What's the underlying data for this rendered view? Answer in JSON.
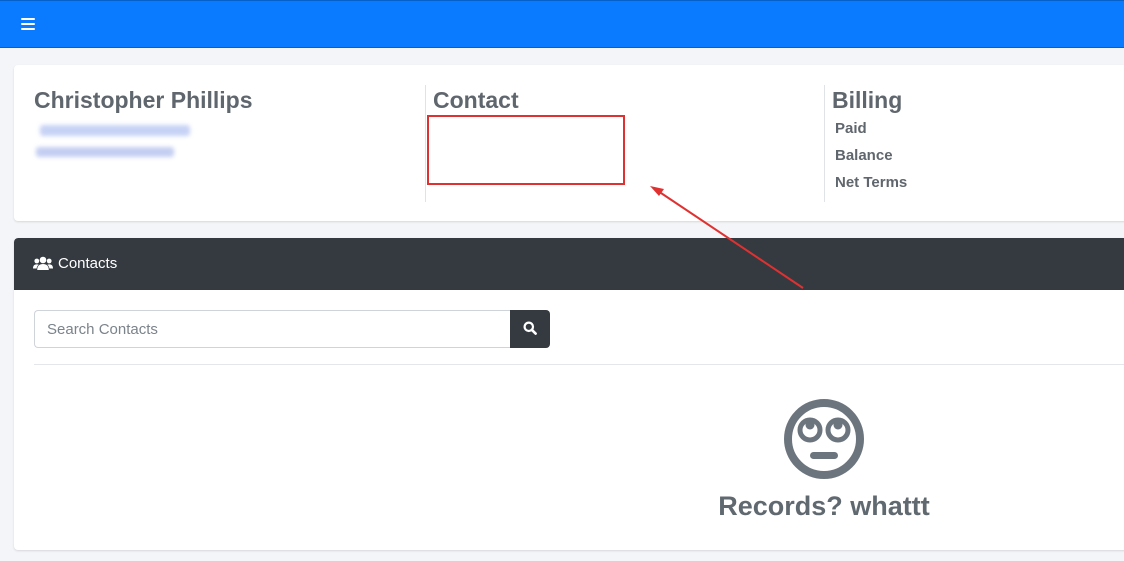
{
  "topbar": {
    "menu_icon": "hamburger-menu-icon",
    "color": "#0a7bff"
  },
  "customer": {
    "name": "Christopher Phillips"
  },
  "contact": {
    "heading": "Contact"
  },
  "billing": {
    "heading": "Billing",
    "items": [
      {
        "label": "Paid"
      },
      {
        "label": "Balance"
      },
      {
        "label": "Net Terms"
      }
    ]
  },
  "contacts_panel": {
    "title": "Contacts",
    "icon": "users-icon",
    "search": {
      "placeholder": "Search Contacts",
      "value": "",
      "button_icon": "search-icon"
    },
    "empty_state": {
      "icon": "rolling-eyes-face-icon",
      "message": "Records? whattt"
    }
  },
  "annotation": {
    "color": "#e03131"
  }
}
